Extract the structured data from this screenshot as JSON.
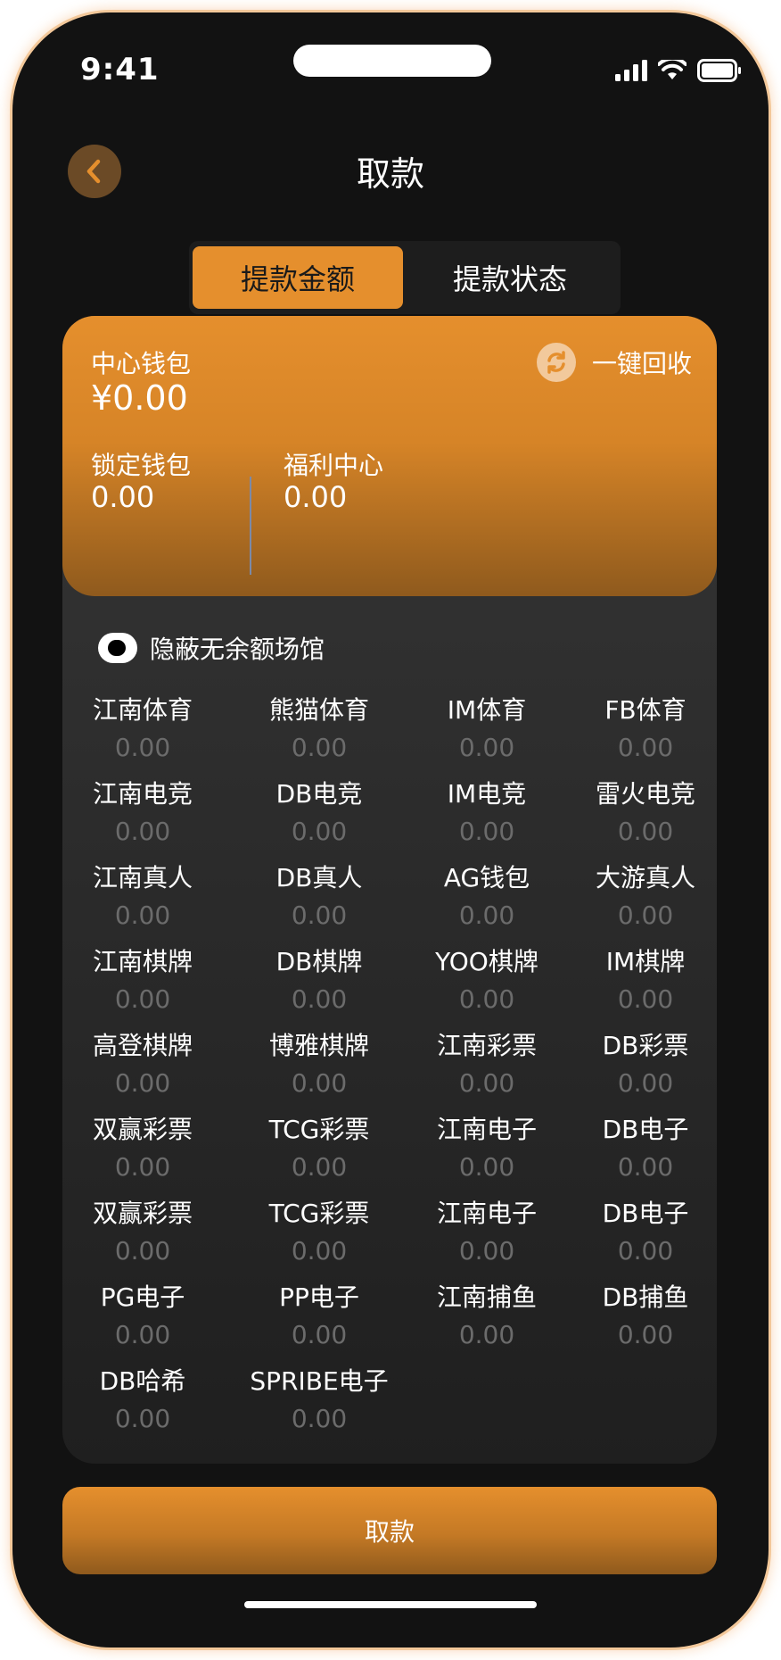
{
  "status_bar": {
    "time": "9:41"
  },
  "header": {
    "title": "取款"
  },
  "tabs": [
    {
      "label": "提款金额",
      "active": true
    },
    {
      "label": "提款状态",
      "active": false
    }
  ],
  "wallet": {
    "center_label": "中心钱包",
    "center_value": "¥0.00",
    "recycle_label": "一键回收",
    "locked_label": "锁定钱包",
    "locked_value": "0.00",
    "welfare_label": "福利中心",
    "welfare_value": "0.00"
  },
  "toggle": {
    "label": "隐蔽无余额场馆",
    "on": true
  },
  "venues": [
    {
      "name": "江南体育",
      "value": "0.00"
    },
    {
      "name": "熊猫体育",
      "value": "0.00"
    },
    {
      "name": "IM体育",
      "value": "0.00"
    },
    {
      "name": "FB体育",
      "value": "0.00"
    },
    {
      "name": "江南电竞",
      "value": "0.00"
    },
    {
      "name": "DB电竞",
      "value": "0.00"
    },
    {
      "name": "IM电竞",
      "value": "0.00"
    },
    {
      "name": "雷火电竞",
      "value": "0.00"
    },
    {
      "name": "江南真人",
      "value": "0.00"
    },
    {
      "name": "DB真人",
      "value": "0.00"
    },
    {
      "name": "AG钱包",
      "value": "0.00"
    },
    {
      "name": "大游真人",
      "value": "0.00"
    },
    {
      "name": "江南棋牌",
      "value": "0.00"
    },
    {
      "name": "DB棋牌",
      "value": "0.00"
    },
    {
      "name": "YOO棋牌",
      "value": "0.00"
    },
    {
      "name": "IM棋牌",
      "value": "0.00"
    },
    {
      "name": "高登棋牌",
      "value": "0.00"
    },
    {
      "name": "博雅棋牌",
      "value": "0.00"
    },
    {
      "name": "江南彩票",
      "value": "0.00"
    },
    {
      "name": "DB彩票",
      "value": "0.00"
    },
    {
      "name": "双赢彩票",
      "value": "0.00"
    },
    {
      "name": "TCG彩票",
      "value": "0.00"
    },
    {
      "name": "江南电子",
      "value": "0.00"
    },
    {
      "name": "DB电子",
      "value": "0.00"
    },
    {
      "name": "双赢彩票",
      "value": "0.00"
    },
    {
      "name": "TCG彩票",
      "value": "0.00"
    },
    {
      "name": "江南电子",
      "value": "0.00"
    },
    {
      "name": "DB电子",
      "value": "0.00"
    },
    {
      "name": "PG电子",
      "value": "0.00"
    },
    {
      "name": "PP电子",
      "value": "0.00"
    },
    {
      "name": "江南捕鱼",
      "value": "0.00"
    },
    {
      "name": "DB捕鱼",
      "value": "0.00"
    },
    {
      "name": "DB哈希",
      "value": "0.00"
    },
    {
      "name": "SPRIBE电子",
      "value": "0.00"
    }
  ],
  "footer": {
    "withdraw_label": "取款"
  },
  "colors": {
    "accent": "#e58f2d",
    "background": "#121212",
    "panel": "#2a2a2a",
    "muted_value": "#6b6b6b"
  },
  "icons": {
    "back": "chevron-left-icon",
    "recycle": "refresh-icon",
    "signal": "signal-icon",
    "wifi": "wifi-icon",
    "battery": "battery-icon"
  }
}
